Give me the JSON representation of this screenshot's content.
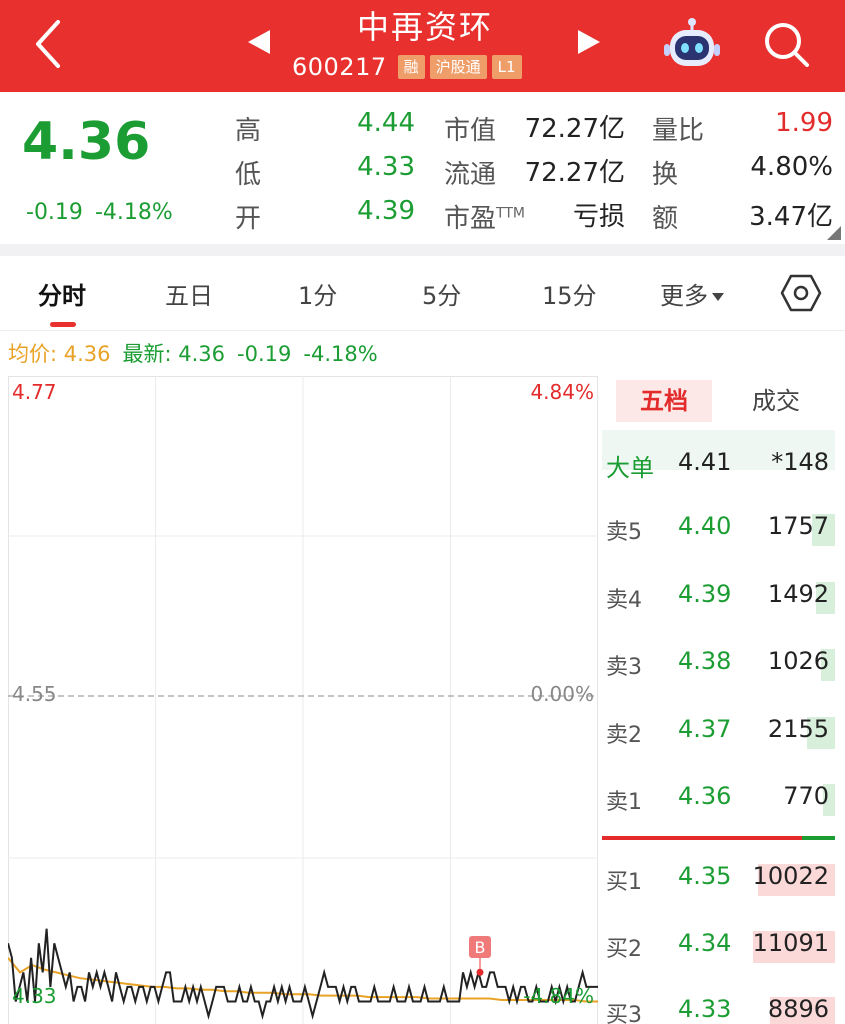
{
  "header": {
    "stock_name": "中再资环",
    "stock_code": "600217",
    "tags": [
      "融",
      "沪股通",
      "L1"
    ],
    "colors": {
      "bar": "#e8312f",
      "tag": "#ef9e6a"
    }
  },
  "quote": {
    "price": "4.36",
    "change": "-0.19",
    "change_pct": "-4.18%",
    "rows": [
      {
        "l1": "高",
        "v1": "4.44",
        "l2": "市值",
        "v2": "72.27亿",
        "l3": "量比",
        "v3": "1.99"
      },
      {
        "l1": "低",
        "v1": "4.33",
        "l2": "流通",
        "v2": "72.27亿",
        "l3": "换",
        "v3": "4.80%"
      },
      {
        "l1": "开",
        "v1": "4.39",
        "l2": "市盈",
        "l2_sup": "TTM",
        "v2": "亏损",
        "l3": "额",
        "v3": "3.47亿"
      }
    ]
  },
  "tabs": {
    "items": [
      "分时",
      "五日",
      "1分",
      "5分",
      "15分",
      "更多"
    ],
    "active": "分时"
  },
  "indicator": {
    "avg_label": "均价: 4.36",
    "latest_label": "最新: 4.36",
    "change": "-0.19",
    "change_pct": "-4.18%"
  },
  "chart_data": {
    "type": "line",
    "y_top": "4.77",
    "y_mid": "4.55",
    "y_bottom": "4.33",
    "pct_top": "4.84%",
    "pct_mid": "0.00%",
    "pct_bottom": "-4.84%",
    "ylim": [
      4.33,
      4.77
    ],
    "prev_close": 4.55,
    "marker": "B",
    "marker_x": 0.8,
    "series": [
      {
        "color": "#222222",
        "values": [
          4.38,
          4.37,
          4.34,
          4.35,
          4.36,
          4.34,
          4.37,
          4.34,
          4.38,
          4.36,
          4.39,
          4.35,
          4.38,
          4.37,
          4.36,
          4.35,
          4.36,
          4.34,
          4.35,
          4.35,
          4.34,
          4.36,
          4.35,
          4.36,
          4.35,
          4.36,
          4.35,
          4.34,
          4.36,
          4.35,
          4.34,
          4.35,
          4.35,
          4.34,
          4.35,
          4.35,
          4.34,
          4.35,
          4.35,
          4.34,
          4.35,
          4.36,
          4.36,
          4.34,
          4.34,
          4.34,
          4.35,
          4.34,
          4.35,
          4.34,
          4.35,
          4.34,
          4.33,
          4.34,
          4.35,
          4.35,
          4.35,
          4.34,
          4.34,
          4.34,
          4.35,
          4.34,
          4.34,
          4.35,
          4.34,
          4.34,
          4.33,
          4.34,
          4.34,
          4.35,
          4.34,
          4.35,
          4.34,
          4.35,
          4.34,
          4.34,
          4.34,
          4.35,
          4.34,
          4.33,
          4.34,
          4.35,
          4.36,
          4.35,
          4.35,
          4.35,
          4.34,
          4.35,
          4.34,
          4.35,
          4.35,
          4.34,
          4.34,
          4.34,
          4.34,
          4.35,
          4.34,
          4.34,
          4.34,
          4.34,
          4.35,
          4.34,
          4.34,
          4.34,
          4.35,
          4.34,
          4.34,
          4.34,
          4.35,
          4.34,
          4.34,
          4.34,
          4.34,
          4.35,
          4.34,
          4.34,
          4.34,
          4.34,
          4.36,
          4.35,
          4.36,
          4.35,
          4.36,
          4.35,
          4.35,
          4.36,
          4.36,
          4.35,
          4.35,
          4.35,
          4.34,
          4.35,
          4.34,
          4.35,
          4.35,
          4.34,
          4.34,
          4.35,
          4.34,
          4.34,
          4.34,
          4.35,
          4.34,
          4.35,
          4.34,
          4.35,
          4.34,
          4.34,
          4.35,
          4.36,
          4.35,
          4.35,
          4.35,
          4.35
        ]
      },
      {
        "color": "#e8a226",
        "values": [
          4.37,
          4.36,
          4.365,
          4.362,
          4.36,
          4.358,
          4.356,
          4.355,
          4.354,
          4.353,
          4.352,
          4.351,
          4.35,
          4.35,
          4.349,
          4.349,
          4.348,
          4.348,
          4.347,
          4.347,
          4.346,
          4.346,
          4.346,
          4.345,
          4.345,
          4.345,
          4.344,
          4.344,
          4.344,
          4.344,
          4.343,
          4.343,
          4.343,
          4.343,
          4.343,
          4.342,
          4.342,
          4.342,
          4.342,
          4.342,
          4.342,
          4.341,
          4.341,
          4.341,
          4.341,
          4.341,
          4.341,
          4.341,
          4.34,
          4.34
        ]
      }
    ]
  },
  "orderbook": {
    "tab_active": "五档",
    "tab_other": "成交",
    "big_order": {
      "label": "大单",
      "price": "4.41",
      "volume": "*148"
    },
    "asks": [
      {
        "label": "卖5",
        "price": "4.40",
        "volume": "1757",
        "bar": 0.1
      },
      {
        "label": "卖4",
        "price": "4.39",
        "volume": "1492",
        "bar": 0.08
      },
      {
        "label": "卖3",
        "price": "4.38",
        "volume": "1026",
        "bar": 0.06
      },
      {
        "label": "卖2",
        "price": "4.37",
        "volume": "2155",
        "bar": 0.12
      },
      {
        "label": "卖1",
        "price": "4.36",
        "volume": "770",
        "bar": 0.05
      }
    ],
    "bids": [
      {
        "label": "买1",
        "price": "4.35",
        "volume": "10022",
        "bar": 0.33
      },
      {
        "label": "买2",
        "price": "4.34",
        "volume": "11091",
        "bar": 0.35
      },
      {
        "label": "买3",
        "price": "4.33",
        "volume": "8896",
        "bar": 0.28
      }
    ]
  }
}
